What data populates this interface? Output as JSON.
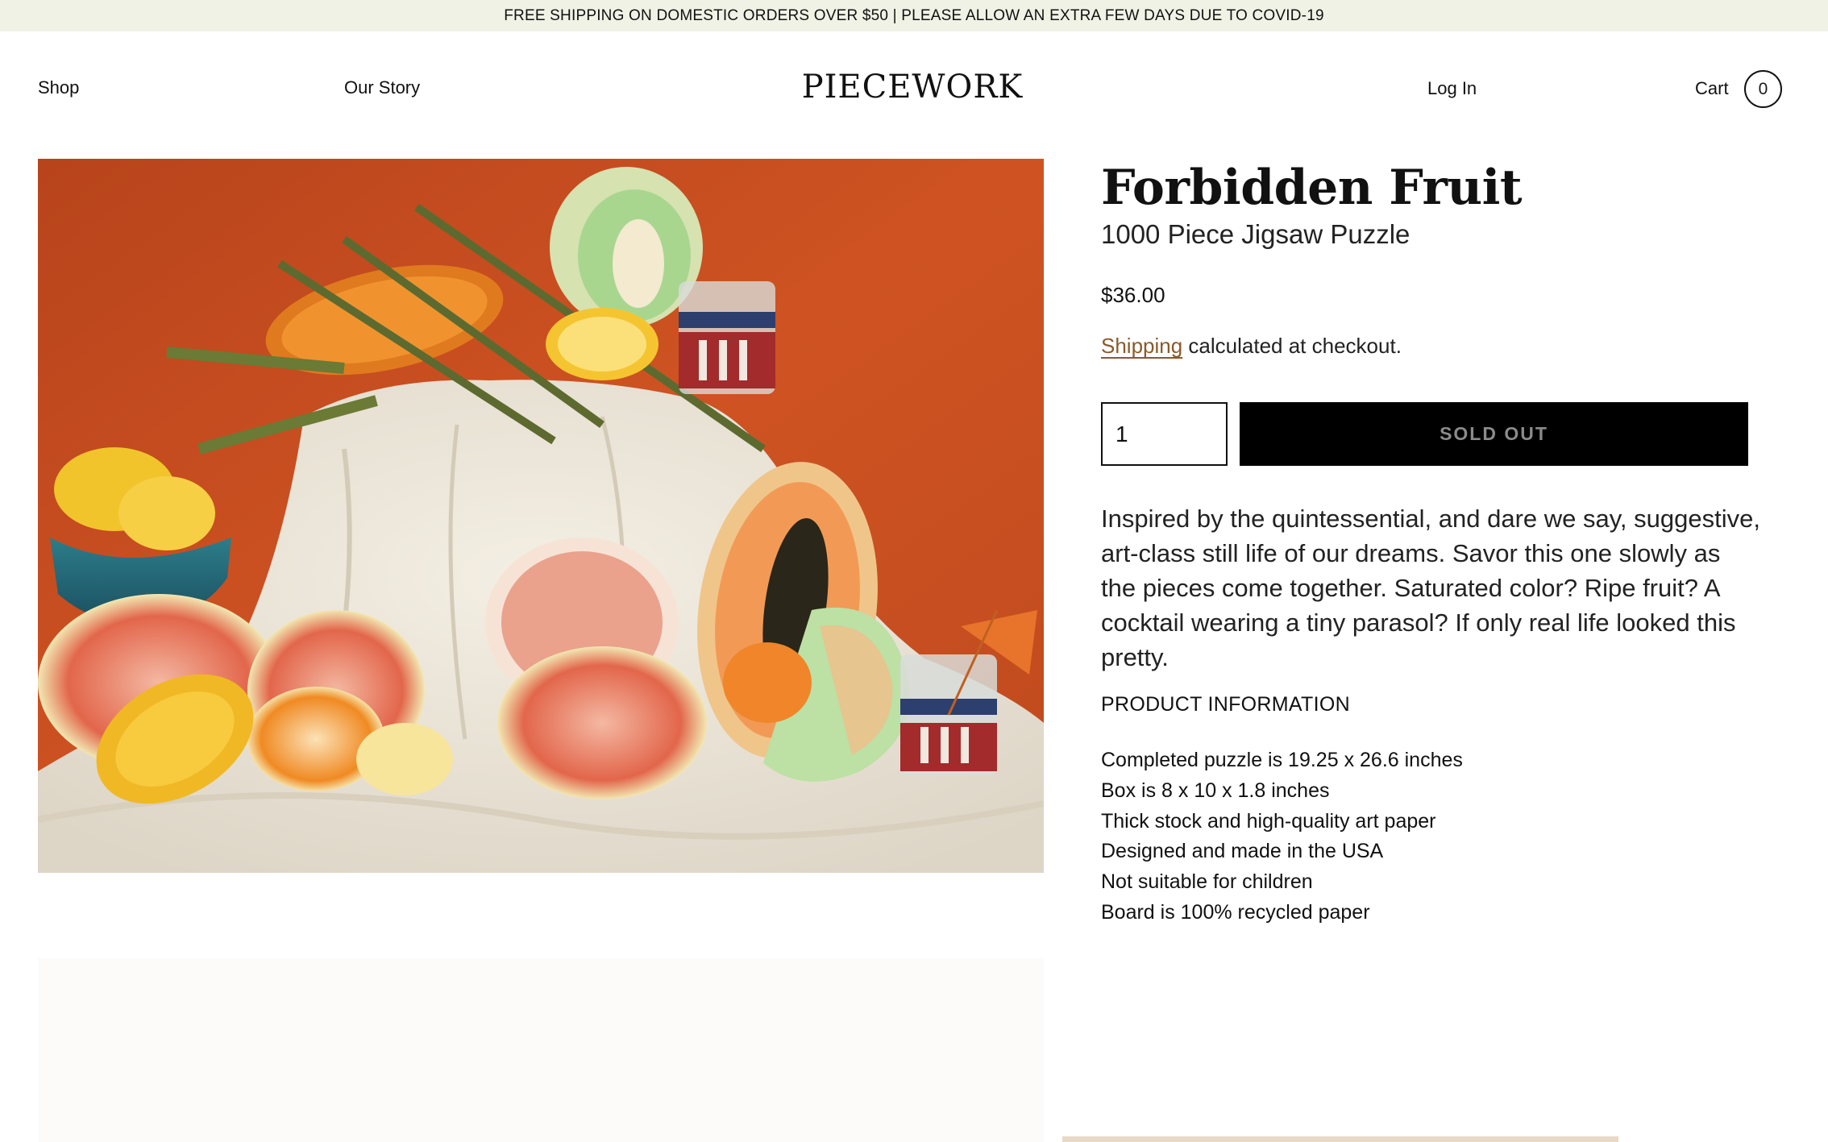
{
  "announcement": "FREE SHIPPING ON DOMESTIC ORDERS OVER $50 | PLEASE ALLOW AN EXTRA FEW DAYS DUE TO COVID-19",
  "nav": {
    "shop": "Shop",
    "our_story": "Our Story",
    "logo": "PIECEWORK",
    "login": "Log In",
    "cart": "Cart",
    "cart_count": "0"
  },
  "product": {
    "title": "Forbidden Fruit",
    "subtitle": "1000 Piece Jigsaw Puzzle",
    "price": "$36.00",
    "shipping_link": "Shipping",
    "shipping_text": " calculated at checkout.",
    "quantity": "1",
    "button": "SOLD OUT",
    "description": "Inspired by the quintessential, and dare we say, suggestive, art-class still life of our dreams. Savor this one slowly as the pieces come together. Saturated color? Ripe fruit? A cocktail wearing a tiny parasol? If only real life looked this pretty.",
    "info_heading": "PRODUCT INFORMATION",
    "info": [
      "Completed puzzle is 19.25 x 26.6 inches",
      "Box is 8 x 10 x 1.8 inches",
      "Thick stock and high-quality art paper",
      "Designed and made in the USA",
      "Not suitable for children",
      "Board is 100% recycled paper"
    ]
  },
  "colors": {
    "announcement_bg": "#f1f2e6",
    "accent_link": "#8a5a2b",
    "button_bg": "#000000",
    "button_text": "#8b8b8b",
    "photo_backdrop": "#c84a1f"
  }
}
